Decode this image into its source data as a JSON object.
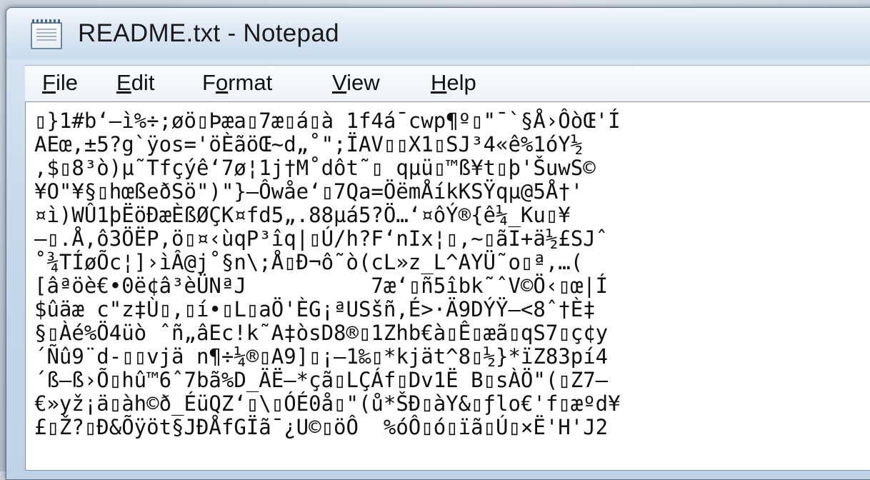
{
  "window": {
    "title": "README.txt - Notepad",
    "icon": "notepad-icon"
  },
  "menu": [
    {
      "label": "File",
      "accel": "F"
    },
    {
      "label": "Edit",
      "accel": "E"
    },
    {
      "label": "Format",
      "accel": "o"
    },
    {
      "label": "View",
      "accel": "V"
    },
    {
      "label": "Help",
      "accel": "H"
    }
  ],
  "editor": {
    "lines": [
      "▯}1#b‘–ì%÷;øö▯Þæa▯7æ▯á▯à 1f4á¯cwp¶º▯\"¯`§Å›ÔòŒ'Í",
      "AEœ,±5?g`ÿos='öÈãöŒ~d„˚\";ÏAV▯▯X1▯SJ³4«ê%1óY½",
      ",$▯8³ò)µ˜Tfçýê‘7ø¦1j†M˚dôt˜▯ qµü▯™ß¥t▯þ'ŠuwS©",
      "¥O\"¥§▯hœßeðSö\")\"}–Ôwåe‘▯7Qa=ÖëmÅíkKSŸqµ@5Å†'",
      "¤ì)WÛ1þËöÐæÈßØÇK¤fd5„.88µá5?Ö…‘¤ôÝ®{ê¼_Ku▯¥",
      "–▯.Å,ô3ÖËP,ö▯¤‹ùqP³îq|▯Ú/h?F‘nIx¦▯,~▯ãI+ä½£SJˆ",
      "˚¾TÍøÕc¦]›ìÂ@j˚§n\\;Å▯Ð¬ô˜ò(cL»z_L^AYÜ˜o▯ª,…(",
      "[âªöè€•0ë¢â³èÜNªJ          7æ‘▯ñ5îbk˜ˆV©Ö‹▯œ|Í",
      "$ûäæ c\"z‡Ù▯,▯í•▯L▯aÖ'ÈG¡ªUSšñ,É>·Ä9DÝŸ–<8ˆ†È‡",
      "§▯Àé%Ö4üò ˆñ„âEc!k˜A‡òsD8®▯1Zhb€à▯Ê▯æã▯qS7▯ç¢y",
      "´Ñû9¨d-▯▯vjä n¶÷¼®▯A9]▯¡–1‰▯*kjät^8▯½}*ïZ83pí4",
      "´ß–ß›Õ▯hû™6ˆ7bã%D_ÄË–*çã▯LÇÁf▯Dv1Ë B▯sÀÖ\"(▯Z7–",
      "€»yž¡ä▯àh©ð_ÉüQZ‘▯\\▯ÓÉ0å▯\"(ů*ŠÐ▯àY&▯ƒlo€'f▯æºd¥",
      "£▯Ž?▯Ð&Õÿöt§JÐÅfGÏã¯¿U©▯öÔ  %óÔ▯ó▯ïã▯Ú▯×Ë'H'J2"
    ]
  }
}
